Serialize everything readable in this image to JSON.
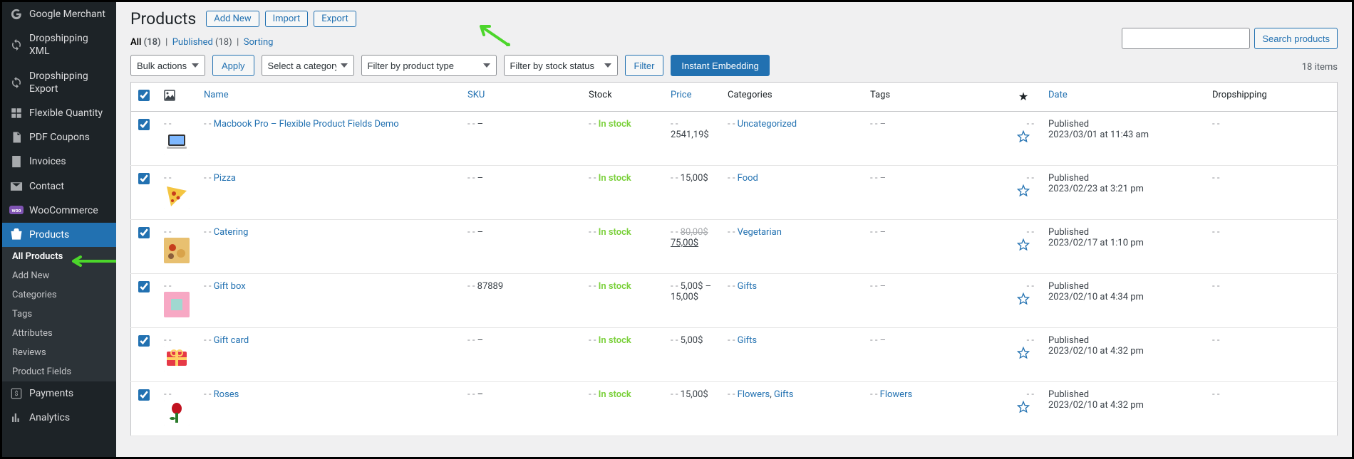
{
  "sidebar": {
    "items": [
      {
        "icon": "google",
        "label": "Google Merchant"
      },
      {
        "icon": "refresh",
        "label": "Dropshipping XML"
      },
      {
        "icon": "refresh",
        "label": "Dropshipping Export"
      },
      {
        "icon": "grid",
        "label": "Flexible Quantity"
      },
      {
        "icon": "pdf",
        "label": "PDF Coupons"
      },
      {
        "icon": "invoice",
        "label": "Invoices"
      },
      {
        "icon": "mail",
        "label": "Contact"
      },
      {
        "icon": "woo",
        "label": "WooCommerce"
      },
      {
        "icon": "products",
        "label": "Products",
        "current": true
      },
      {
        "icon": "dollar",
        "label": "Payments"
      },
      {
        "icon": "chart",
        "label": "Analytics"
      }
    ],
    "sub": [
      {
        "label": "All Products",
        "active": true
      },
      {
        "label": "Add New"
      },
      {
        "label": "Categories"
      },
      {
        "label": "Tags"
      },
      {
        "label": "Attributes"
      },
      {
        "label": "Reviews"
      },
      {
        "label": "Product Fields"
      }
    ]
  },
  "header": {
    "title": "Products",
    "add_new": "Add New",
    "import": "Import",
    "export": "Export"
  },
  "subsubsub": {
    "all_label": "All",
    "all_count": "(18)",
    "published_label": "Published",
    "published_count": "(18)",
    "sorting_label": "Sorting"
  },
  "filters": {
    "bulk": "Bulk actions",
    "apply": "Apply",
    "category": "Select a category",
    "type": "Filter by product type",
    "stock": "Filter by stock status",
    "filter_btn": "Filter",
    "instant": "Instant Embedding"
  },
  "search": {
    "placeholder": "",
    "button": "Search products"
  },
  "items_count": "18 items",
  "columns": {
    "name": "Name",
    "sku": "SKU",
    "stock": "Stock",
    "price": "Price",
    "categories": "Categories",
    "tags": "Tags",
    "date": "Date",
    "dropshipping": "Dropshipping"
  },
  "rows": [
    {
      "checked": true,
      "thumb": "macbook",
      "name": "Macbook Pro – Flexible Product Fields Demo",
      "sku": "–",
      "stock": "In stock",
      "price": "2541,19$",
      "categories": [
        {
          "t": "Uncategorized"
        }
      ],
      "tags": "–",
      "pub": "Published",
      "date": "2023/03/01 at 11:43 am",
      "ds": "-"
    },
    {
      "checked": true,
      "thumb": "pizza",
      "name": "Pizza",
      "sku": "–",
      "stock": "In stock",
      "price": "15,00$",
      "categories": [
        {
          "t": "Food"
        }
      ],
      "tags": "–",
      "pub": "Published",
      "date": "2023/02/23 at 3:21 pm",
      "ds": "-"
    },
    {
      "checked": true,
      "thumb": "catering",
      "name": "Catering",
      "sku": "–",
      "stock": "In stock",
      "old_price": "80,00$",
      "price": "75,00$",
      "categories": [
        {
          "t": "Vegetarian"
        }
      ],
      "tags": "–",
      "pub": "Published",
      "date": "2023/02/17 at 1:10 pm",
      "ds": "-"
    },
    {
      "checked": true,
      "thumb": "giftbox",
      "name": "Gift box",
      "sku": "87889",
      "stock": "In stock",
      "price": "5,00$ – 15,00$",
      "categories": [
        {
          "t": "Gifts"
        }
      ],
      "tags": "–",
      "pub": "Published",
      "date": "2023/02/10 at 4:34 pm",
      "ds": "-"
    },
    {
      "checked": true,
      "thumb": "giftcard",
      "name": "Gift card",
      "sku": "–",
      "stock": "In stock",
      "price": "5,00$",
      "categories": [
        {
          "t": "Gifts"
        }
      ],
      "tags": "–",
      "pub": "Published",
      "date": "2023/02/10 at 4:32 pm",
      "ds": "-"
    },
    {
      "checked": true,
      "thumb": "roses",
      "name": "Roses",
      "sku": "–",
      "stock": "In stock",
      "price": "15,00$",
      "categories": [
        {
          "t": "Flowers"
        },
        {
          "t": "Gifts"
        }
      ],
      "tags": [
        {
          "t": "Flowers"
        }
      ],
      "pub": "Published",
      "date": "2023/02/10 at 4:32 pm",
      "ds": "-"
    }
  ]
}
